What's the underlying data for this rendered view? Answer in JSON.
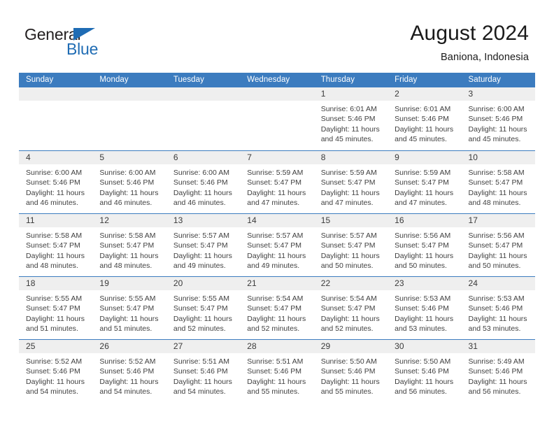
{
  "brand": {
    "name_part1": "General",
    "name_part2": "Blue",
    "triangle_icon": "blue-triangle-logo-mark",
    "colors": {
      "dark": "#231f20",
      "blue": "#1f6cb4"
    }
  },
  "header": {
    "title": "August 2024",
    "subtitle": "Baniona, Indonesia"
  },
  "theme": {
    "header_bar": "#3c7cbf",
    "day_band": "#efefef",
    "row_divider": "#3c7cbf",
    "text": "#404040"
  },
  "weekdays": [
    "Sunday",
    "Monday",
    "Tuesday",
    "Wednesday",
    "Thursday",
    "Friday",
    "Saturday"
  ],
  "labels": {
    "sunrise_prefix": "Sunrise:",
    "sunset_prefix": "Sunset:",
    "daylight_prefix": "Daylight:"
  },
  "weeks": [
    [
      {
        "day": "",
        "empty": true,
        "sunrise": "",
        "sunset": "",
        "daylight_line1": "",
        "daylight_line2": ""
      },
      {
        "day": "",
        "empty": true,
        "sunrise": "",
        "sunset": "",
        "daylight_line1": "",
        "daylight_line2": ""
      },
      {
        "day": "",
        "empty": true,
        "sunrise": "",
        "sunset": "",
        "daylight_line1": "",
        "daylight_line2": ""
      },
      {
        "day": "",
        "empty": true,
        "sunrise": "",
        "sunset": "",
        "daylight_line1": "",
        "daylight_line2": ""
      },
      {
        "day": "1",
        "empty": false,
        "sunrise": "Sunrise: 6:01 AM",
        "sunset": "Sunset: 5:46 PM",
        "daylight_line1": "Daylight: 11 hours",
        "daylight_line2": "and 45 minutes."
      },
      {
        "day": "2",
        "empty": false,
        "sunrise": "Sunrise: 6:01 AM",
        "sunset": "Sunset: 5:46 PM",
        "daylight_line1": "Daylight: 11 hours",
        "daylight_line2": "and 45 minutes."
      },
      {
        "day": "3",
        "empty": false,
        "sunrise": "Sunrise: 6:00 AM",
        "sunset": "Sunset: 5:46 PM",
        "daylight_line1": "Daylight: 11 hours",
        "daylight_line2": "and 45 minutes."
      }
    ],
    [
      {
        "day": "4",
        "empty": false,
        "sunrise": "Sunrise: 6:00 AM",
        "sunset": "Sunset: 5:46 PM",
        "daylight_line1": "Daylight: 11 hours",
        "daylight_line2": "and 46 minutes."
      },
      {
        "day": "5",
        "empty": false,
        "sunrise": "Sunrise: 6:00 AM",
        "sunset": "Sunset: 5:46 PM",
        "daylight_line1": "Daylight: 11 hours",
        "daylight_line2": "and 46 minutes."
      },
      {
        "day": "6",
        "empty": false,
        "sunrise": "Sunrise: 6:00 AM",
        "sunset": "Sunset: 5:46 PM",
        "daylight_line1": "Daylight: 11 hours",
        "daylight_line2": "and 46 minutes."
      },
      {
        "day": "7",
        "empty": false,
        "sunrise": "Sunrise: 5:59 AM",
        "sunset": "Sunset: 5:47 PM",
        "daylight_line1": "Daylight: 11 hours",
        "daylight_line2": "and 47 minutes."
      },
      {
        "day": "8",
        "empty": false,
        "sunrise": "Sunrise: 5:59 AM",
        "sunset": "Sunset: 5:47 PM",
        "daylight_line1": "Daylight: 11 hours",
        "daylight_line2": "and 47 minutes."
      },
      {
        "day": "9",
        "empty": false,
        "sunrise": "Sunrise: 5:59 AM",
        "sunset": "Sunset: 5:47 PM",
        "daylight_line1": "Daylight: 11 hours",
        "daylight_line2": "and 47 minutes."
      },
      {
        "day": "10",
        "empty": false,
        "sunrise": "Sunrise: 5:58 AM",
        "sunset": "Sunset: 5:47 PM",
        "daylight_line1": "Daylight: 11 hours",
        "daylight_line2": "and 48 minutes."
      }
    ],
    [
      {
        "day": "11",
        "empty": false,
        "sunrise": "Sunrise: 5:58 AM",
        "sunset": "Sunset: 5:47 PM",
        "daylight_line1": "Daylight: 11 hours",
        "daylight_line2": "and 48 minutes."
      },
      {
        "day": "12",
        "empty": false,
        "sunrise": "Sunrise: 5:58 AM",
        "sunset": "Sunset: 5:47 PM",
        "daylight_line1": "Daylight: 11 hours",
        "daylight_line2": "and 48 minutes."
      },
      {
        "day": "13",
        "empty": false,
        "sunrise": "Sunrise: 5:57 AM",
        "sunset": "Sunset: 5:47 PM",
        "daylight_line1": "Daylight: 11 hours",
        "daylight_line2": "and 49 minutes."
      },
      {
        "day": "14",
        "empty": false,
        "sunrise": "Sunrise: 5:57 AM",
        "sunset": "Sunset: 5:47 PM",
        "daylight_line1": "Daylight: 11 hours",
        "daylight_line2": "and 49 minutes."
      },
      {
        "day": "15",
        "empty": false,
        "sunrise": "Sunrise: 5:57 AM",
        "sunset": "Sunset: 5:47 PM",
        "daylight_line1": "Daylight: 11 hours",
        "daylight_line2": "and 50 minutes."
      },
      {
        "day": "16",
        "empty": false,
        "sunrise": "Sunrise: 5:56 AM",
        "sunset": "Sunset: 5:47 PM",
        "daylight_line1": "Daylight: 11 hours",
        "daylight_line2": "and 50 minutes."
      },
      {
        "day": "17",
        "empty": false,
        "sunrise": "Sunrise: 5:56 AM",
        "sunset": "Sunset: 5:47 PM",
        "daylight_line1": "Daylight: 11 hours",
        "daylight_line2": "and 50 minutes."
      }
    ],
    [
      {
        "day": "18",
        "empty": false,
        "sunrise": "Sunrise: 5:55 AM",
        "sunset": "Sunset: 5:47 PM",
        "daylight_line1": "Daylight: 11 hours",
        "daylight_line2": "and 51 minutes."
      },
      {
        "day": "19",
        "empty": false,
        "sunrise": "Sunrise: 5:55 AM",
        "sunset": "Sunset: 5:47 PM",
        "daylight_line1": "Daylight: 11 hours",
        "daylight_line2": "and 51 minutes."
      },
      {
        "day": "20",
        "empty": false,
        "sunrise": "Sunrise: 5:55 AM",
        "sunset": "Sunset: 5:47 PM",
        "daylight_line1": "Daylight: 11 hours",
        "daylight_line2": "and 52 minutes."
      },
      {
        "day": "21",
        "empty": false,
        "sunrise": "Sunrise: 5:54 AM",
        "sunset": "Sunset: 5:47 PM",
        "daylight_line1": "Daylight: 11 hours",
        "daylight_line2": "and 52 minutes."
      },
      {
        "day": "22",
        "empty": false,
        "sunrise": "Sunrise: 5:54 AM",
        "sunset": "Sunset: 5:47 PM",
        "daylight_line1": "Daylight: 11 hours",
        "daylight_line2": "and 52 minutes."
      },
      {
        "day": "23",
        "empty": false,
        "sunrise": "Sunrise: 5:53 AM",
        "sunset": "Sunset: 5:46 PM",
        "daylight_line1": "Daylight: 11 hours",
        "daylight_line2": "and 53 minutes."
      },
      {
        "day": "24",
        "empty": false,
        "sunrise": "Sunrise: 5:53 AM",
        "sunset": "Sunset: 5:46 PM",
        "daylight_line1": "Daylight: 11 hours",
        "daylight_line2": "and 53 minutes."
      }
    ],
    [
      {
        "day": "25",
        "empty": false,
        "sunrise": "Sunrise: 5:52 AM",
        "sunset": "Sunset: 5:46 PM",
        "daylight_line1": "Daylight: 11 hours",
        "daylight_line2": "and 54 minutes."
      },
      {
        "day": "26",
        "empty": false,
        "sunrise": "Sunrise: 5:52 AM",
        "sunset": "Sunset: 5:46 PM",
        "daylight_line1": "Daylight: 11 hours",
        "daylight_line2": "and 54 minutes."
      },
      {
        "day": "27",
        "empty": false,
        "sunrise": "Sunrise: 5:51 AM",
        "sunset": "Sunset: 5:46 PM",
        "daylight_line1": "Daylight: 11 hours",
        "daylight_line2": "and 54 minutes."
      },
      {
        "day": "28",
        "empty": false,
        "sunrise": "Sunrise: 5:51 AM",
        "sunset": "Sunset: 5:46 PM",
        "daylight_line1": "Daylight: 11 hours",
        "daylight_line2": "and 55 minutes."
      },
      {
        "day": "29",
        "empty": false,
        "sunrise": "Sunrise: 5:50 AM",
        "sunset": "Sunset: 5:46 PM",
        "daylight_line1": "Daylight: 11 hours",
        "daylight_line2": "and 55 minutes."
      },
      {
        "day": "30",
        "empty": false,
        "sunrise": "Sunrise: 5:50 AM",
        "sunset": "Sunset: 5:46 PM",
        "daylight_line1": "Daylight: 11 hours",
        "daylight_line2": "and 56 minutes."
      },
      {
        "day": "31",
        "empty": false,
        "sunrise": "Sunrise: 5:49 AM",
        "sunset": "Sunset: 5:46 PM",
        "daylight_line1": "Daylight: 11 hours",
        "daylight_line2": "and 56 minutes."
      }
    ]
  ]
}
